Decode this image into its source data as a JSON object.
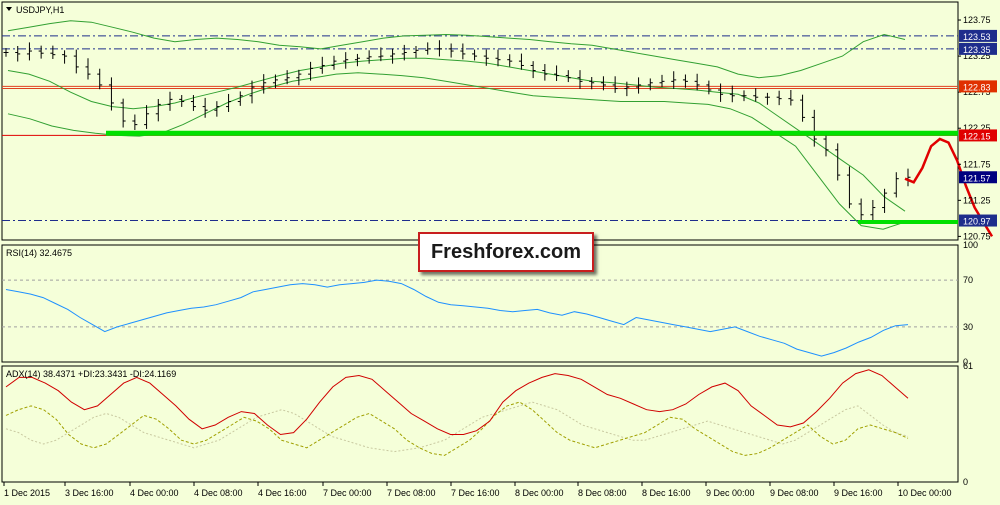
{
  "main_chart": {
    "symbol_label": "USDJPY,H1",
    "y_ticks": [
      "123.75",
      "123.25",
      "122.75",
      "122.25",
      "121.75",
      "121.25",
      "120.75"
    ],
    "price_badges": [
      {
        "value": "123.53",
        "kind": "level",
        "color": "#1E2D8C"
      },
      {
        "value": "123.35",
        "kind": "level",
        "color": "#1E2D8C"
      },
      {
        "value": "122.83",
        "kind": "level",
        "color": "#E03000"
      },
      {
        "value": "122.15",
        "kind": "level",
        "color": "#E00000"
      },
      {
        "value": "121.57",
        "kind": "current",
        "color": "#000080"
      },
      {
        "value": "120.97",
        "kind": "level",
        "color": "#1E2D8C"
      }
    ],
    "colors": {
      "candles": "#000000",
      "bollinger": "#32A032",
      "support": "#00E000",
      "resistance_line": "#E04020",
      "forecast": "#E00000",
      "dashdot": "#1E2D8C"
    }
  },
  "rsi_panel": {
    "label": "RSI(14) 32.4675",
    "ticks": [
      "100",
      "70",
      "30",
      "0"
    ],
    "color": "#1E90FF"
  },
  "adx_panel": {
    "label": "ADX(14) 38.4371 +DI:23.3431 -DI:24.1169",
    "ticks": [
      "61",
      "0"
    ],
    "colors": {
      "adx": "#D00000",
      "plus_di": "#A0A000",
      "minus_di": "#C8C8A0"
    }
  },
  "x_labels": [
    "1 Dec 2015",
    "3 Dec 16:00",
    "4 Dec 00:00",
    "4 Dec 08:00",
    "4 Dec 16:00",
    "7 Dec 00:00",
    "7 Dec 08:00",
    "7 Dec 16:00",
    "8 Dec 00:00",
    "8 Dec 08:00",
    "8 Dec 16:00",
    "9 Dec 00:00",
    "9 Dec 08:00",
    "9 Dec 16:00",
    "10 Dec 00:00"
  ],
  "watermark": "Freshforex.com",
  "chart_data": [
    {
      "type": "line",
      "title": "USDJPY,H1",
      "ylim": [
        120.7,
        124.0
      ],
      "x_tick_labels": [
        "1 Dec 2015",
        "3 Dec 16:00",
        "4 Dec 00:00",
        "4 Dec 08:00",
        "4 Dec 16:00",
        "7 Dec 00:00",
        "7 Dec 08:00",
        "7 Dec 16:00",
        "8 Dec 00:00",
        "8 Dec 08:00",
        "8 Dec 16:00",
        "9 Dec 00:00",
        "9 Dec 08:00",
        "9 Dec 16:00",
        "10 Dec 00:00"
      ],
      "series": [
        {
          "values": [
            123.3,
            123.28,
            123.32,
            123.29,
            123.27,
            123.25,
            123.1,
            123.0,
            122.85,
            122.6,
            122.35,
            122.3,
            122.45,
            122.58,
            122.65,
            122.62,
            122.55,
            122.5,
            122.55,
            122.62,
            122.7,
            122.82,
            122.88,
            122.92,
            122.95,
            123.0,
            123.08,
            123.12,
            123.18,
            123.2,
            123.22,
            123.24,
            123.25,
            123.28,
            123.3,
            123.33,
            123.35,
            123.35,
            123.32,
            123.28,
            123.25,
            123.22,
            123.2,
            123.18,
            123.12,
            123.05,
            123.0,
            122.98,
            122.95,
            122.9,
            122.88,
            122.85,
            122.8,
            122.82,
            122.85,
            122.88,
            122.9,
            122.92,
            122.9,
            122.85,
            122.78,
            122.72,
            122.7,
            122.7,
            122.68,
            122.68,
            122.66,
            122.64,
            122.4,
            122.1,
            121.95,
            121.6,
            121.2,
            121.05,
            121.15,
            121.35,
            121.55,
            121.57
          ]
        },
        {
          "values": [
            123.6,
            123.65,
            123.7,
            123.74,
            123.72,
            123.65,
            123.58,
            123.5,
            123.45,
            123.48,
            123.5,
            123.48,
            123.45,
            123.4,
            123.38,
            123.35,
            123.4,
            123.45,
            123.5,
            123.53,
            123.54,
            123.55,
            123.54,
            123.52,
            123.5,
            123.48,
            123.45,
            123.42,
            123.4,
            123.35,
            123.3,
            123.25,
            123.2,
            123.15,
            123.1,
            123.0,
            122.95,
            122.98,
            123.05,
            123.15,
            123.25,
            123.45,
            123.55,
            123.48
          ]
        },
        {
          "values": [
            123.05,
            123.0,
            122.9,
            122.75,
            122.62,
            122.55,
            122.52,
            122.55,
            122.6,
            122.68,
            122.75,
            122.82,
            122.9,
            122.98,
            123.05,
            123.1,
            123.15,
            123.18,
            123.2,
            123.22,
            123.22,
            123.2,
            123.18,
            123.15,
            123.1,
            123.05,
            123.0,
            122.95,
            122.9,
            122.88,
            122.85,
            122.82,
            122.8,
            122.78,
            122.75,
            122.72,
            122.6,
            122.4,
            122.2,
            122.0,
            121.8,
            121.6,
            121.3,
            121.1
          ]
        },
        {
          "values": [
            122.45,
            122.38,
            122.28,
            122.22,
            122.18,
            122.15,
            122.14,
            122.18,
            122.3,
            122.45,
            122.6,
            122.72,
            122.82,
            122.9,
            122.95,
            123.0,
            123.02,
            123.0,
            122.98,
            122.95,
            122.9,
            122.85,
            122.8,
            122.75,
            122.7,
            122.68,
            122.66,
            122.64,
            122.62,
            122.62,
            122.62,
            122.6,
            122.58,
            122.52,
            122.4,
            122.2,
            122.0,
            121.6,
            121.2,
            120.9,
            120.85,
            120.95
          ]
        },
        {
          "name": "forecast",
          "values": [
            121.55,
            121.5,
            121.7,
            122.0,
            122.1,
            122.05,
            121.8,
            121.45,
            121.15,
            120.95,
            120.75
          ]
        }
      ],
      "levels": [
        123.53,
        123.35,
        122.83,
        122.15,
        120.97
      ]
    },
    {
      "type": "line",
      "title": "RSI(14) 32.4675",
      "ylim": [
        0,
        100
      ],
      "levels": [
        70,
        30
      ],
      "series": [
        {
          "values": [
            62,
            60,
            58,
            55,
            50,
            45,
            38,
            32,
            26,
            30,
            33,
            36,
            39,
            42,
            44,
            46,
            47,
            49,
            52,
            55,
            60,
            62,
            64,
            66,
            67,
            66,
            64,
            66,
            67,
            68,
            70,
            69,
            67,
            62,
            56,
            51,
            49,
            48,
            47,
            46,
            44,
            43,
            44,
            45,
            42,
            40,
            43,
            41,
            38,
            35,
            32,
            38,
            36,
            34,
            32,
            30,
            28,
            26,
            28,
            30,
            26,
            22,
            19,
            16,
            11,
            8,
            5,
            8,
            12,
            17,
            21,
            27,
            31,
            32
          ]
        }
      ]
    },
    {
      "type": "line",
      "title": "ADX(14) 38.4371 +DI:23.3431 -DI:24.1169",
      "ylim": [
        0,
        61
      ],
      "series": [
        {
          "values": [
            50,
            55,
            55,
            52,
            48,
            42,
            38,
            40,
            46,
            52,
            55,
            52,
            46,
            40,
            33,
            28,
            30,
            34,
            37,
            36,
            30,
            25,
            26,
            33,
            42,
            50,
            55,
            56,
            54,
            48,
            42,
            36,
            32,
            28,
            25,
            25,
            27,
            32,
            42,
            48,
            52,
            55,
            57,
            56,
            54,
            50,
            46,
            44,
            41,
            38,
            37,
            38,
            41,
            46,
            50,
            52,
            48,
            40,
            35,
            30,
            29,
            31,
            37,
            44,
            52,
            57,
            59,
            56,
            50,
            44
          ]
        },
        {
          "values": [
            35,
            38,
            40,
            38,
            33,
            25,
            20,
            18,
            20,
            25,
            30,
            35,
            33,
            28,
            22,
            20,
            22,
            26,
            30,
            34,
            32,
            28,
            22,
            20,
            18,
            22,
            26,
            30,
            34,
            36,
            32,
            28,
            22,
            18,
            15,
            14,
            18,
            22,
            28,
            35,
            40,
            42,
            38,
            32,
            26,
            22,
            20,
            18,
            20,
            22,
            24,
            26,
            30,
            34,
            33,
            28,
            24,
            20,
            16,
            14,
            15,
            18,
            22,
            26,
            30,
            24,
            20,
            22,
            28,
            30,
            28,
            26,
            23
          ]
        },
        {
          "values": [
            28,
            26,
            22,
            20,
            22,
            26,
            30,
            34,
            36,
            34,
            30,
            26,
            24,
            22,
            20,
            18,
            20,
            22,
            26,
            30,
            34,
            36,
            38,
            36,
            32,
            28,
            24,
            22,
            20,
            18,
            17,
            16,
            17,
            18,
            20,
            22,
            26,
            30,
            34,
            36,
            38,
            40,
            42,
            40,
            38,
            34,
            30,
            28,
            26,
            24,
            22,
            22,
            24,
            26,
            28,
            30,
            32,
            30,
            28,
            26,
            24,
            22,
            20,
            22,
            26,
            30,
            34,
            38,
            40,
            35,
            30,
            26,
            24
          ]
        }
      ]
    }
  ]
}
